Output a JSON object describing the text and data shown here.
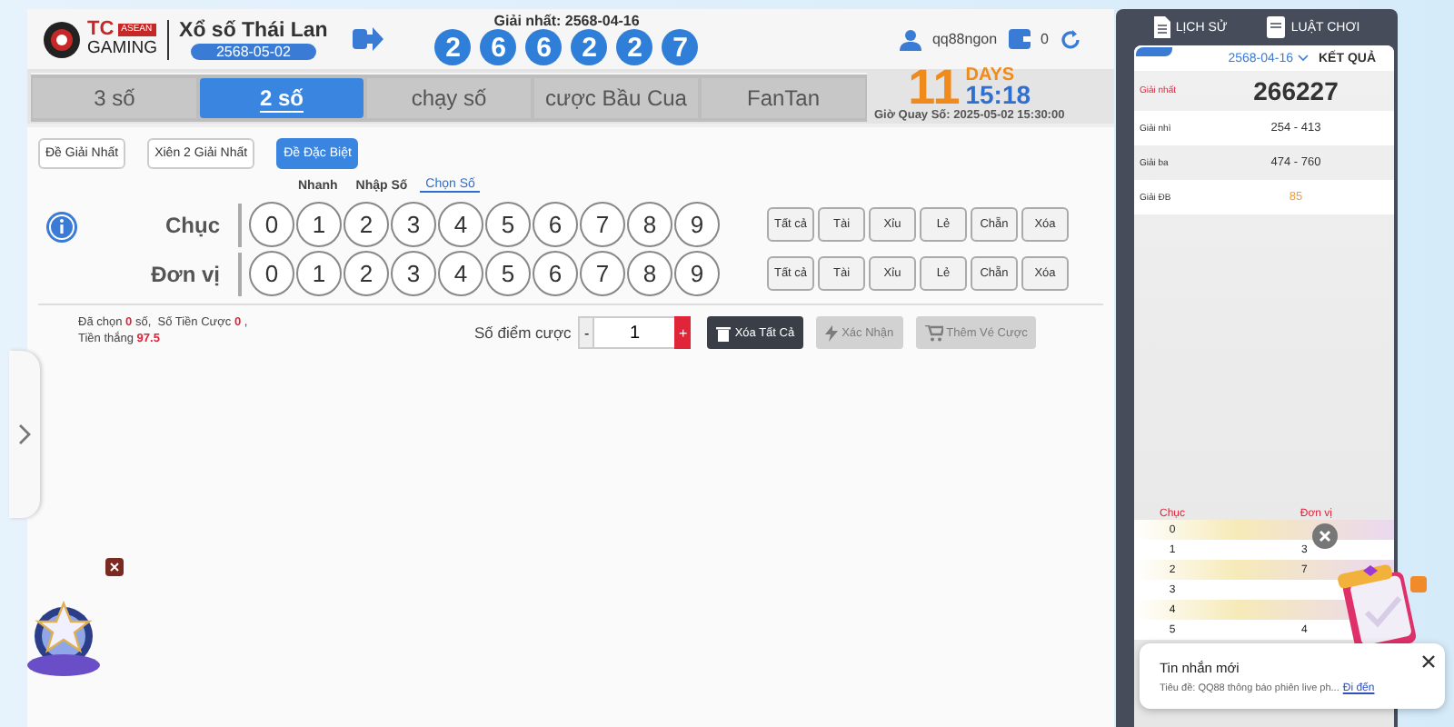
{
  "logo": {
    "brand": "TC",
    "badge": "ASEAN",
    "sub": "GAMING"
  },
  "game": {
    "title": "Xổ số Thái Lan",
    "date": "2568-05-02"
  },
  "first_prize": {
    "label": "Giải nhất: 2568-04-16",
    "digits": [
      "2",
      "6",
      "6",
      "2",
      "2",
      "7"
    ]
  },
  "user": {
    "name": "qq88ngon",
    "balance": "0"
  },
  "tabs": [
    {
      "label": "3 số",
      "selected": false
    },
    {
      "label": "2 số",
      "selected": true
    },
    {
      "label": "chạy số",
      "selected": false
    },
    {
      "label": "cược Bầu Cua",
      "selected": false
    },
    {
      "label": "FanTan",
      "selected": false
    }
  ],
  "countdown": {
    "days": "11",
    "days_label": "DAYS",
    "time": "15:18",
    "draw_time": "Giờ Quay Số: 2025-05-02 15:30:00"
  },
  "bet_types": [
    {
      "label": "Đề Giải Nhất",
      "selected": false
    },
    {
      "label": "Xiên 2 Giải Nhất",
      "selected": false
    },
    {
      "label": "Đề Đặc Biệt",
      "selected": true
    }
  ],
  "modes": [
    {
      "label": "Nhanh",
      "selected": false
    },
    {
      "label": "Nhập Số",
      "selected": false
    },
    {
      "label": "Chọn Số",
      "selected": true
    }
  ],
  "rows": [
    {
      "label": "Chục",
      "numbers": [
        {
          "n": "0",
          "selected": false
        },
        {
          "n": "1",
          "selected": false
        },
        {
          "n": "2",
          "selected": false
        },
        {
          "n": "3",
          "selected": false
        },
        {
          "n": "4",
          "selected": false
        },
        {
          "n": "5",
          "selected": false
        },
        {
          "n": "6",
          "selected": false
        },
        {
          "n": "7",
          "selected": false
        },
        {
          "n": "8",
          "selected": false
        },
        {
          "n": "9",
          "selected": false
        }
      ],
      "quick": [
        "Tất cả",
        "Tài",
        "Xỉu",
        "Lẻ",
        "Chẵn",
        "Xóa"
      ]
    },
    {
      "label": "Đơn vị",
      "numbers": [
        {
          "n": "0",
          "selected": false
        },
        {
          "n": "1",
          "selected": false
        },
        {
          "n": "2",
          "selected": false
        },
        {
          "n": "3",
          "selected": false
        },
        {
          "n": "4",
          "selected": false
        },
        {
          "n": "5",
          "selected": false
        },
        {
          "n": "6",
          "selected": false
        },
        {
          "n": "7",
          "selected": false
        },
        {
          "n": "8",
          "selected": false
        },
        {
          "n": "9",
          "selected": false
        }
      ],
      "quick": [
        "Tất cả",
        "Tài",
        "Xỉu",
        "Lẻ",
        "Chẵn",
        "Xóa"
      ]
    }
  ],
  "summary": {
    "chosen_label": "Đã chọn",
    "chosen": "0",
    "chosen_unit": "số,",
    "stake_label": "Số Tiền Cược",
    "stake": "0",
    "stake_end": ",",
    "win_label": "Tiền thắng",
    "win": "97.5"
  },
  "bet": {
    "label": "Số điểm cược",
    "minus": "-",
    "value": "1",
    "plus": "+"
  },
  "actions": [
    {
      "label": "Xóa Tất Cả",
      "kind": "clear",
      "disabled": false
    },
    {
      "label": "Xác Nhận",
      "kind": "confirm",
      "disabled": true
    },
    {
      "label": "Thêm Vé Cược",
      "kind": "cart",
      "disabled": true
    }
  ],
  "side_tabs": [
    {
      "label": "LỊCH SỬ",
      "kind": "history"
    },
    {
      "label": "LUẬT CHƠI",
      "kind": "rules"
    }
  ],
  "results": {
    "date": "2568-04-16",
    "heading": "KẾT QUẢ",
    "prizes": [
      {
        "label": "Giải nhất",
        "value": "266227",
        "kind": "first"
      },
      {
        "label": "Giải nhì",
        "value": "254 - 413",
        "kind": "normal"
      },
      {
        "label": "Giải ba",
        "value": "474 - 760",
        "kind": "normal"
      },
      {
        "label": "Giải ĐB",
        "value": "85",
        "kind": "special"
      }
    ]
  },
  "stats": {
    "columns": [
      "Chục",
      "Đơn vị"
    ],
    "rows": [
      {
        "tens": "0"
      },
      {
        "tens": "1",
        "units": "3"
      },
      {
        "tens": "2",
        "units": "7"
      },
      {
        "tens": "3"
      },
      {
        "tens": "4"
      },
      {
        "tens": "5",
        "units": "4"
      }
    ]
  },
  "notification": {
    "title": "Tin nhắn mới",
    "body": "Tiêu đề: QQ88 thông báo phiên live ph...",
    "link": "Đi đến"
  }
}
